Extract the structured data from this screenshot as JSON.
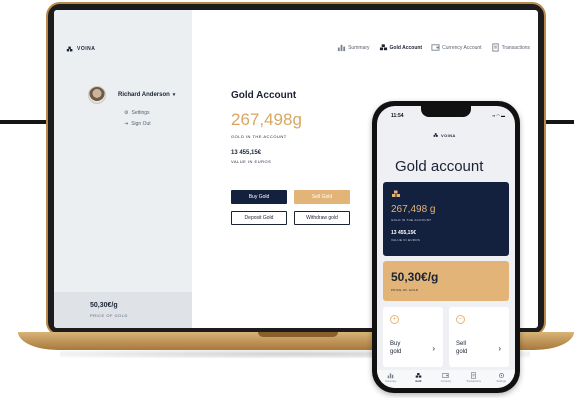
{
  "brand": {
    "name": "VOINA"
  },
  "laptop": {
    "user": {
      "name": "Richard Anderson",
      "menu": [
        "Settings",
        "Sign Out"
      ]
    },
    "nav": [
      {
        "label": "Summary",
        "active": false,
        "icon": "bar-chart-icon"
      },
      {
        "label": "Gold Account",
        "active": true,
        "icon": "gold-bars-icon"
      },
      {
        "label": "Currency Account",
        "active": false,
        "icon": "wallet-icon"
      },
      {
        "label": "Transactions",
        "active": false,
        "icon": "receipt-icon"
      }
    ],
    "title": "Gold Account",
    "gold_amount": "267,498g",
    "gold_label": "GOLD IN THE ACCOUNT",
    "euro_amount": "13 455,15€",
    "euro_label": "VALUE IN EUROS",
    "buttons": {
      "buy": "Buy Gold",
      "sell": "Sell Gold",
      "deposit": "Deposit Gold",
      "withdraw": "Withdraw gold"
    },
    "price": {
      "value": "50,30€/g",
      "label": "PRICE OF GOLD"
    }
  },
  "phone": {
    "time": "11:54",
    "title": "Gold account",
    "gold_amount": "267,498 g",
    "gold_label": "GOLD IN THE ACCOUNT",
    "euro_amount": "13 455,15€",
    "euro_label": "VALUE IN EUROS",
    "price": {
      "value": "50,30€/g",
      "label": "PRICE OF GOLD"
    },
    "tiles": [
      {
        "label": "Buy gold",
        "icon": "plus-circle-icon"
      },
      {
        "label": "Sell gold",
        "icon": "minus-circle-icon"
      }
    ],
    "tabs": [
      {
        "label": "Summary",
        "active": false
      },
      {
        "label": "Gold",
        "active": true
      },
      {
        "label": "Currency",
        "active": false
      },
      {
        "label": "Transactions",
        "active": false
      },
      {
        "label": "Settings",
        "active": false
      }
    ]
  },
  "colors": {
    "navy": "#13213f",
    "gold": "#e3b477",
    "gold_text": "#d9a661"
  }
}
